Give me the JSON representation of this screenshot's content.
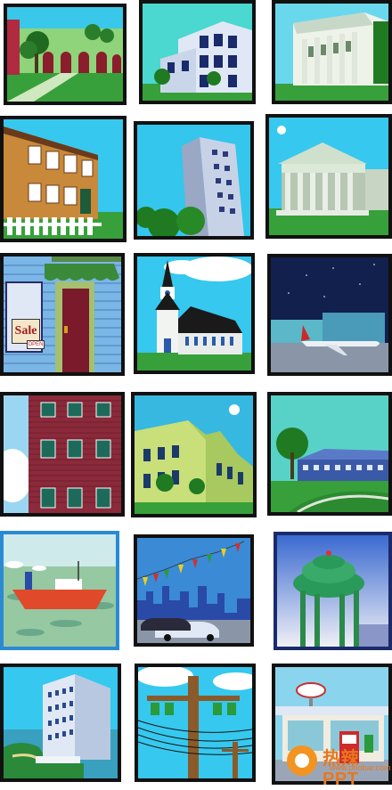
{
  "tiles": [
    {
      "id": "villa"
    },
    {
      "id": "office"
    },
    {
      "id": "bank"
    },
    {
      "id": "townhouse"
    },
    {
      "id": "tower"
    },
    {
      "id": "courthouse"
    },
    {
      "id": "store-front"
    },
    {
      "id": "church"
    },
    {
      "id": "airport"
    },
    {
      "id": "apartments"
    },
    {
      "id": "school"
    },
    {
      "id": "campus"
    },
    {
      "id": "ship"
    },
    {
      "id": "city-cars"
    },
    {
      "id": "water-tower"
    },
    {
      "id": "resort"
    },
    {
      "id": "power-pole"
    },
    {
      "id": "gas-station"
    }
  ],
  "store_sign": {
    "sale": "Sale",
    "open": "OPEN"
  },
  "watermark": {
    "text": "热辣PPT",
    "url": "www.poobar.com"
  },
  "colors": {
    "sky": "#5ad0f0",
    "grass": "#3aa63a",
    "border": "#111111"
  }
}
